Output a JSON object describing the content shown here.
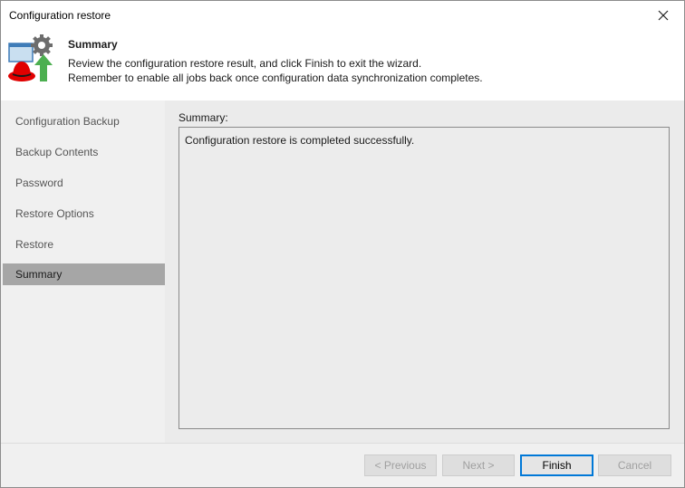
{
  "window": {
    "title": "Configuration restore"
  },
  "header": {
    "title": "Summary",
    "description_line1": "Review the configuration restore result, and click Finish to exit the wizard.",
    "description_line2": "Remember to enable all jobs back once configuration data synchronization completes."
  },
  "sidebar": {
    "items": [
      {
        "label": "Configuration Backup",
        "active": false
      },
      {
        "label": "Backup Contents",
        "active": false
      },
      {
        "label": "Password",
        "active": false
      },
      {
        "label": "Restore Options",
        "active": false
      },
      {
        "label": "Restore",
        "active": false
      },
      {
        "label": "Summary",
        "active": true
      }
    ]
  },
  "main": {
    "summary_label": "Summary:",
    "summary_text": "Configuration restore is completed successfully."
  },
  "footer": {
    "previous_label": "< Previous",
    "next_label": "Next >",
    "finish_label": "Finish",
    "cancel_label": "Cancel"
  },
  "colors": {
    "active_nav": "#a6a6a6",
    "primary_border": "#0078d7"
  }
}
